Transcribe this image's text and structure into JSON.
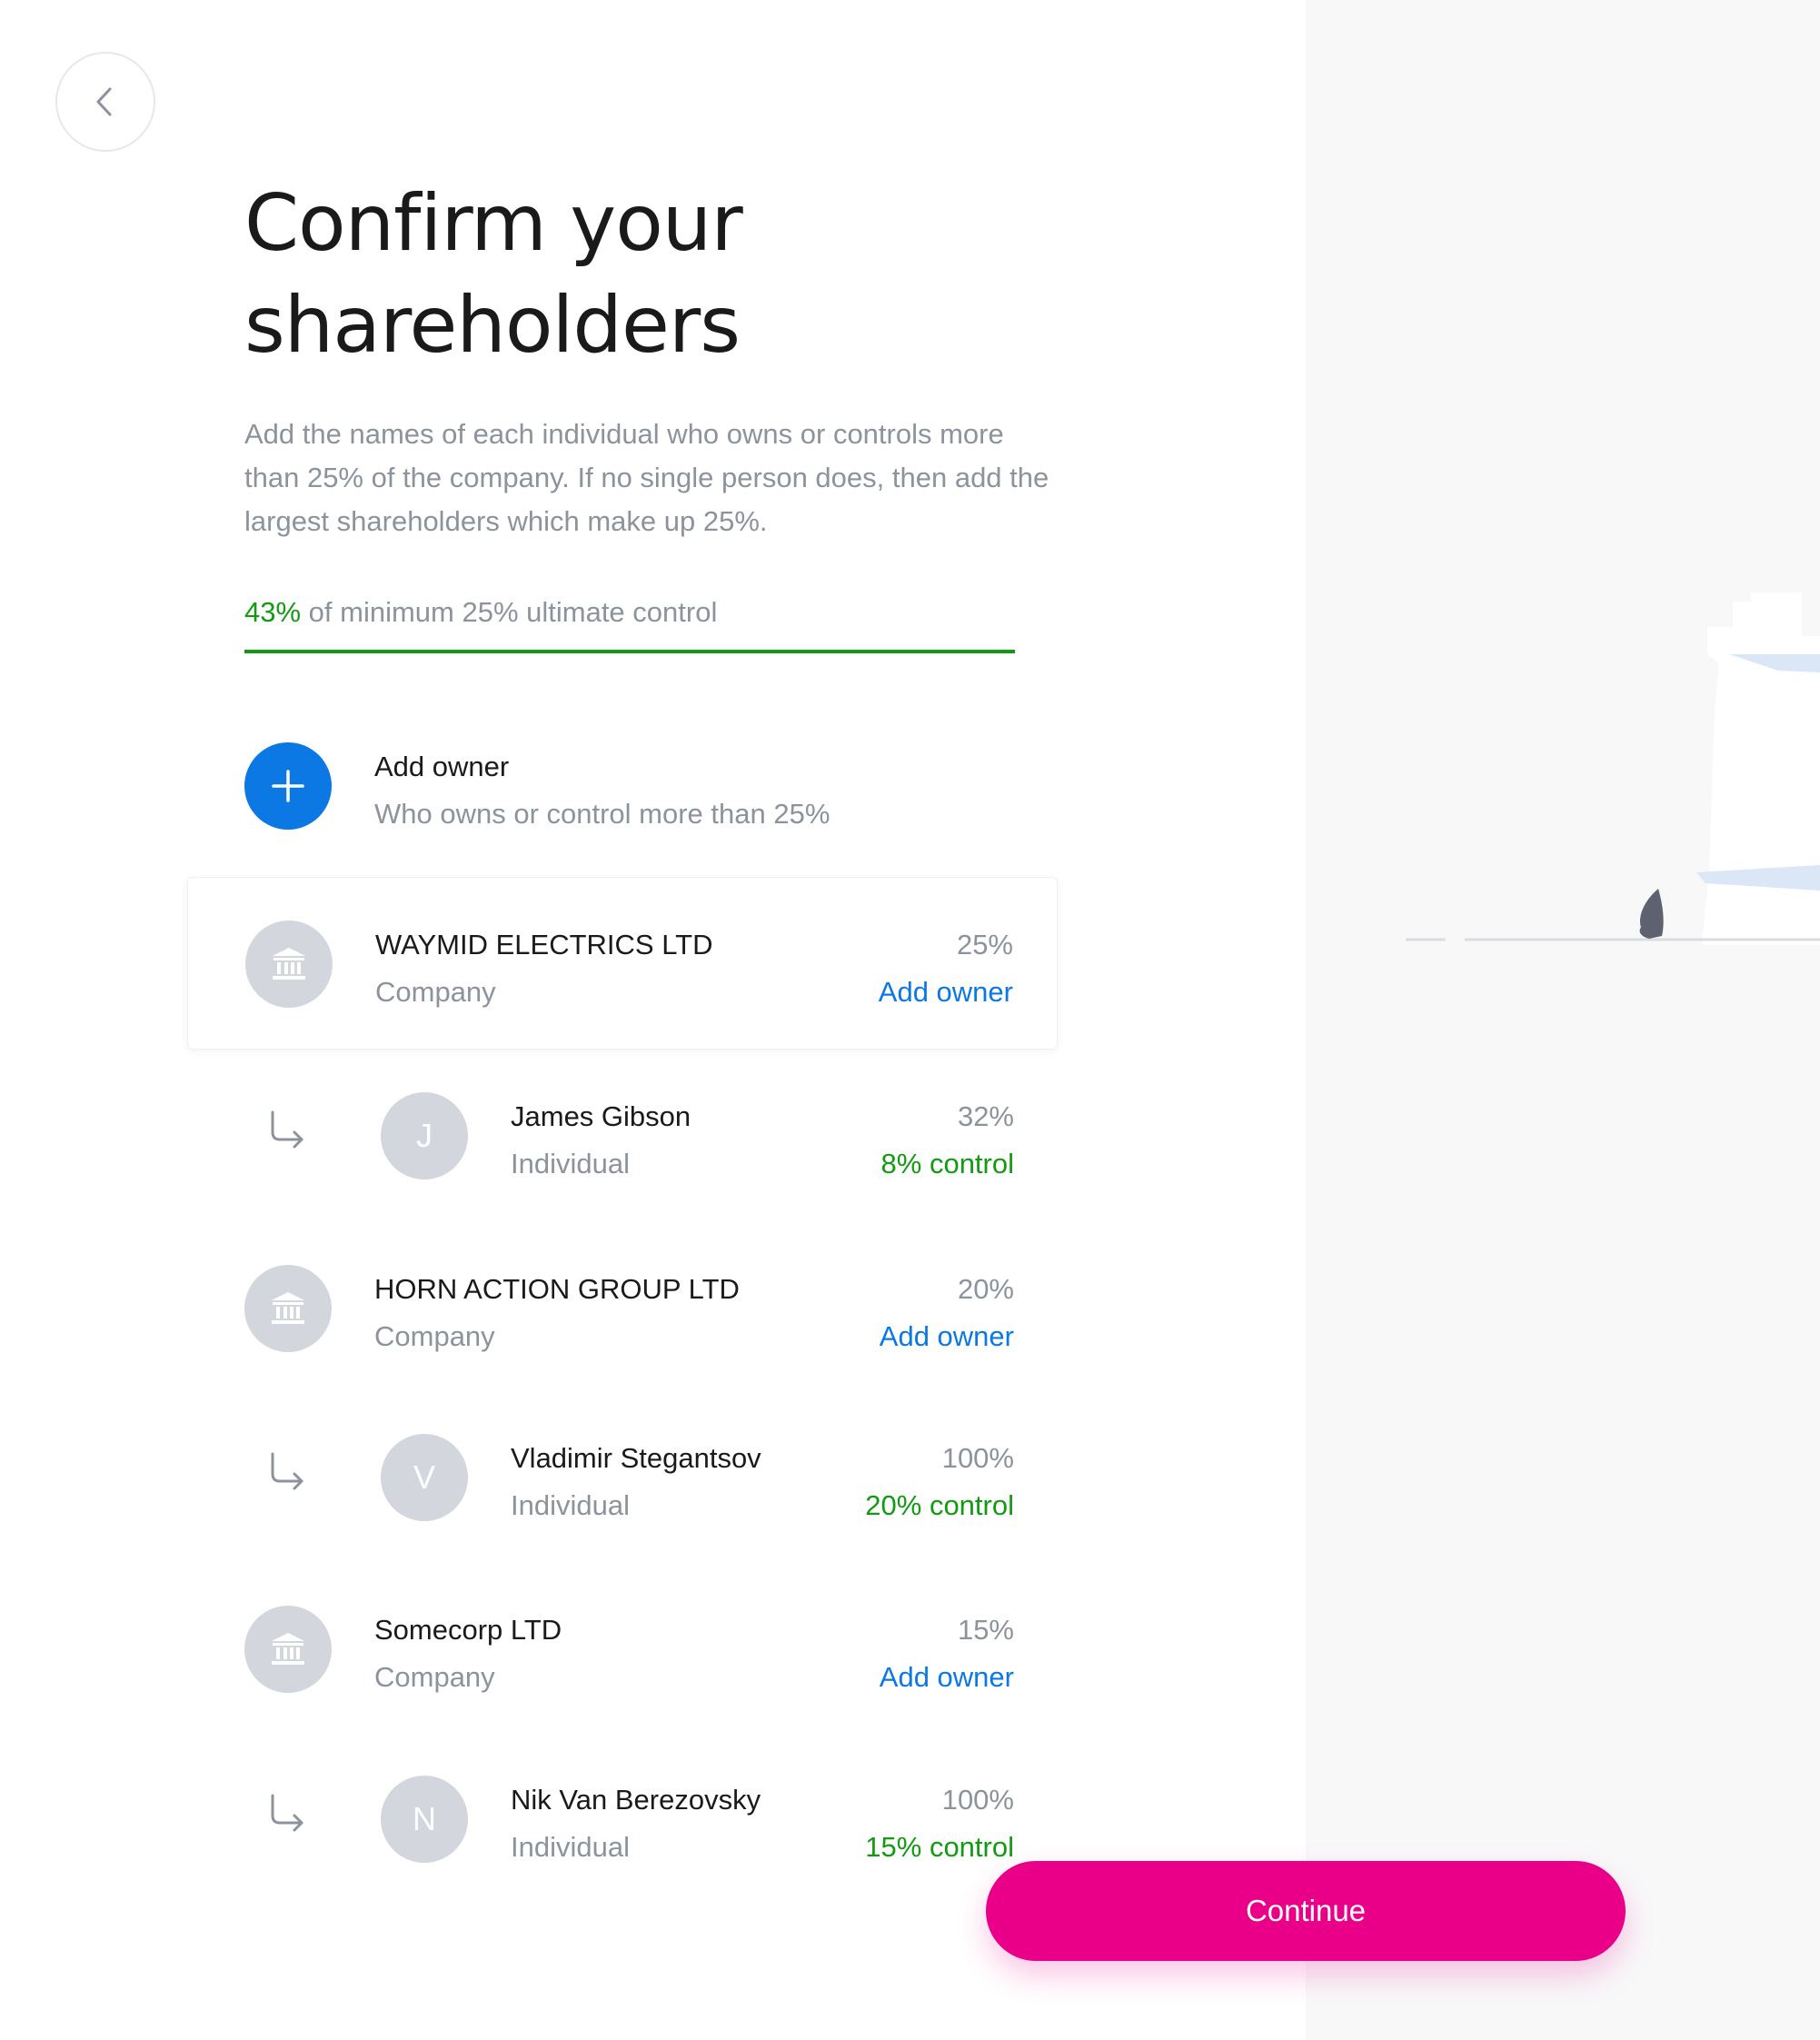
{
  "nav": {
    "back_icon": "chevron-left-icon"
  },
  "heading": {
    "title_line1": "Confirm your",
    "title_line2": "shareholders",
    "description": "Add the names of each individual who owns or controls more than 25% of the company. If no single person does, then add the largest shareholders which make up 25%."
  },
  "progress": {
    "percent_label": "43%",
    "text": " of minimum 25% ultimate control",
    "fill_fraction": 1.0,
    "color": "#129b12"
  },
  "add_owner": {
    "icon": "plus-icon",
    "title": "Add owner",
    "subtitle": "Who owns or control more than 25%"
  },
  "shareholders": [
    {
      "kind": "company",
      "name": "WAYMID ELECTRICS LTD",
      "type": "Company",
      "share": "25%",
      "action": "Add owner",
      "icon": "bank-icon"
    },
    {
      "kind": "individual",
      "initial": "J",
      "name": "James Gibson",
      "type": "Individual",
      "share": "32%",
      "action": "8% control",
      "icon": "subdirectory-arrow-icon"
    },
    {
      "kind": "company",
      "name": "HORN ACTION GROUP LTD",
      "type": "Company",
      "share": "20%",
      "action": "Add owner",
      "icon": "bank-icon"
    },
    {
      "kind": "individual",
      "initial": "V",
      "name": "Vladimir Stegantsov",
      "type": "Individual",
      "share": "100%",
      "action": "20% control",
      "icon": "subdirectory-arrow-icon"
    },
    {
      "kind": "company",
      "name": "Somecorp LTD",
      "type": "Company",
      "share": "15%",
      "action": "Add owner",
      "icon": "bank-icon"
    },
    {
      "kind": "individual",
      "initial": "N",
      "name": "Nik Van Berezovsky",
      "type": "Individual",
      "share": "100%",
      "action": "15% control",
      "icon": "subdirectory-arrow-icon"
    }
  ],
  "footer": {
    "continue_label": "Continue"
  },
  "colors": {
    "accent_blue": "#0b78e3",
    "accent_green": "#129b12",
    "cta_pink": "#ea0088",
    "muted_text": "#8c939d",
    "avatar_gray": "#d3d7dd"
  }
}
